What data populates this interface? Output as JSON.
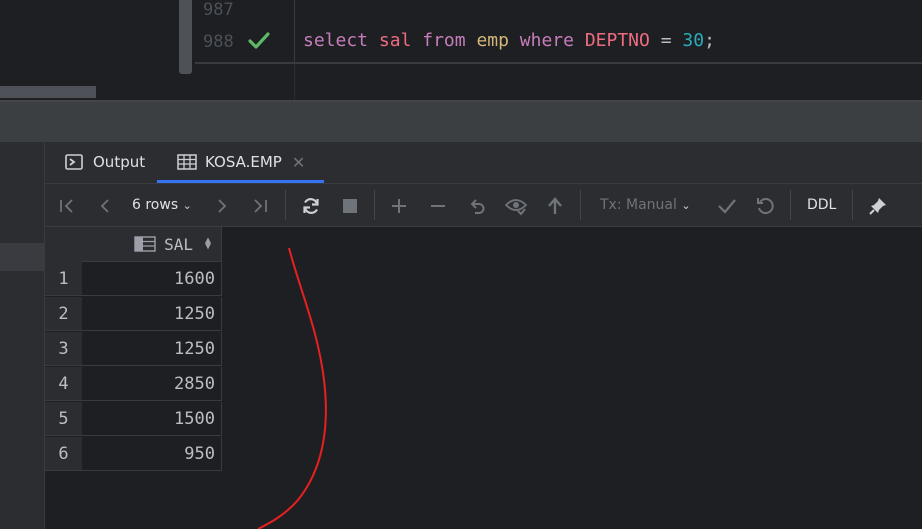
{
  "editor": {
    "lines": [
      {
        "number": "987"
      },
      {
        "number": "988",
        "tokens": {
          "kw1": "select",
          "col": "sal",
          "kw2": "from",
          "table": "emp",
          "kw3": "where",
          "field": "DEPTNO",
          "op": "=",
          "value": "30",
          "end": ";"
        }
      }
    ]
  },
  "tabs": {
    "output": "Output",
    "table": "KOSA.EMP"
  },
  "toolbar": {
    "rows": "6 rows",
    "tx": "Tx: Manual",
    "ddl": "DDL"
  },
  "grid": {
    "column": "SAL",
    "rows": [
      {
        "num": "1",
        "sal": "1600"
      },
      {
        "num": "2",
        "sal": "1250"
      },
      {
        "num": "3",
        "sal": "1250"
      },
      {
        "num": "4",
        "sal": "2850"
      },
      {
        "num": "5",
        "sal": "1500"
      },
      {
        "num": "6",
        "sal": "950"
      }
    ]
  },
  "colors": {
    "accent": "#3574f0",
    "success_check": "#5fb865",
    "annotation": "#e8201f"
  },
  "icons": [
    "checkmark-icon",
    "console-icon",
    "table-icon",
    "close-icon",
    "first-page-icon",
    "prev-page-icon",
    "chevron-down-icon",
    "next-page-icon",
    "last-page-icon",
    "reload-icon",
    "stop-icon",
    "add-row-icon",
    "delete-row-icon",
    "revert-icon",
    "preview-icon",
    "submit-icon",
    "commit-icon",
    "rollback-icon",
    "pin-icon",
    "sort-icon"
  ]
}
